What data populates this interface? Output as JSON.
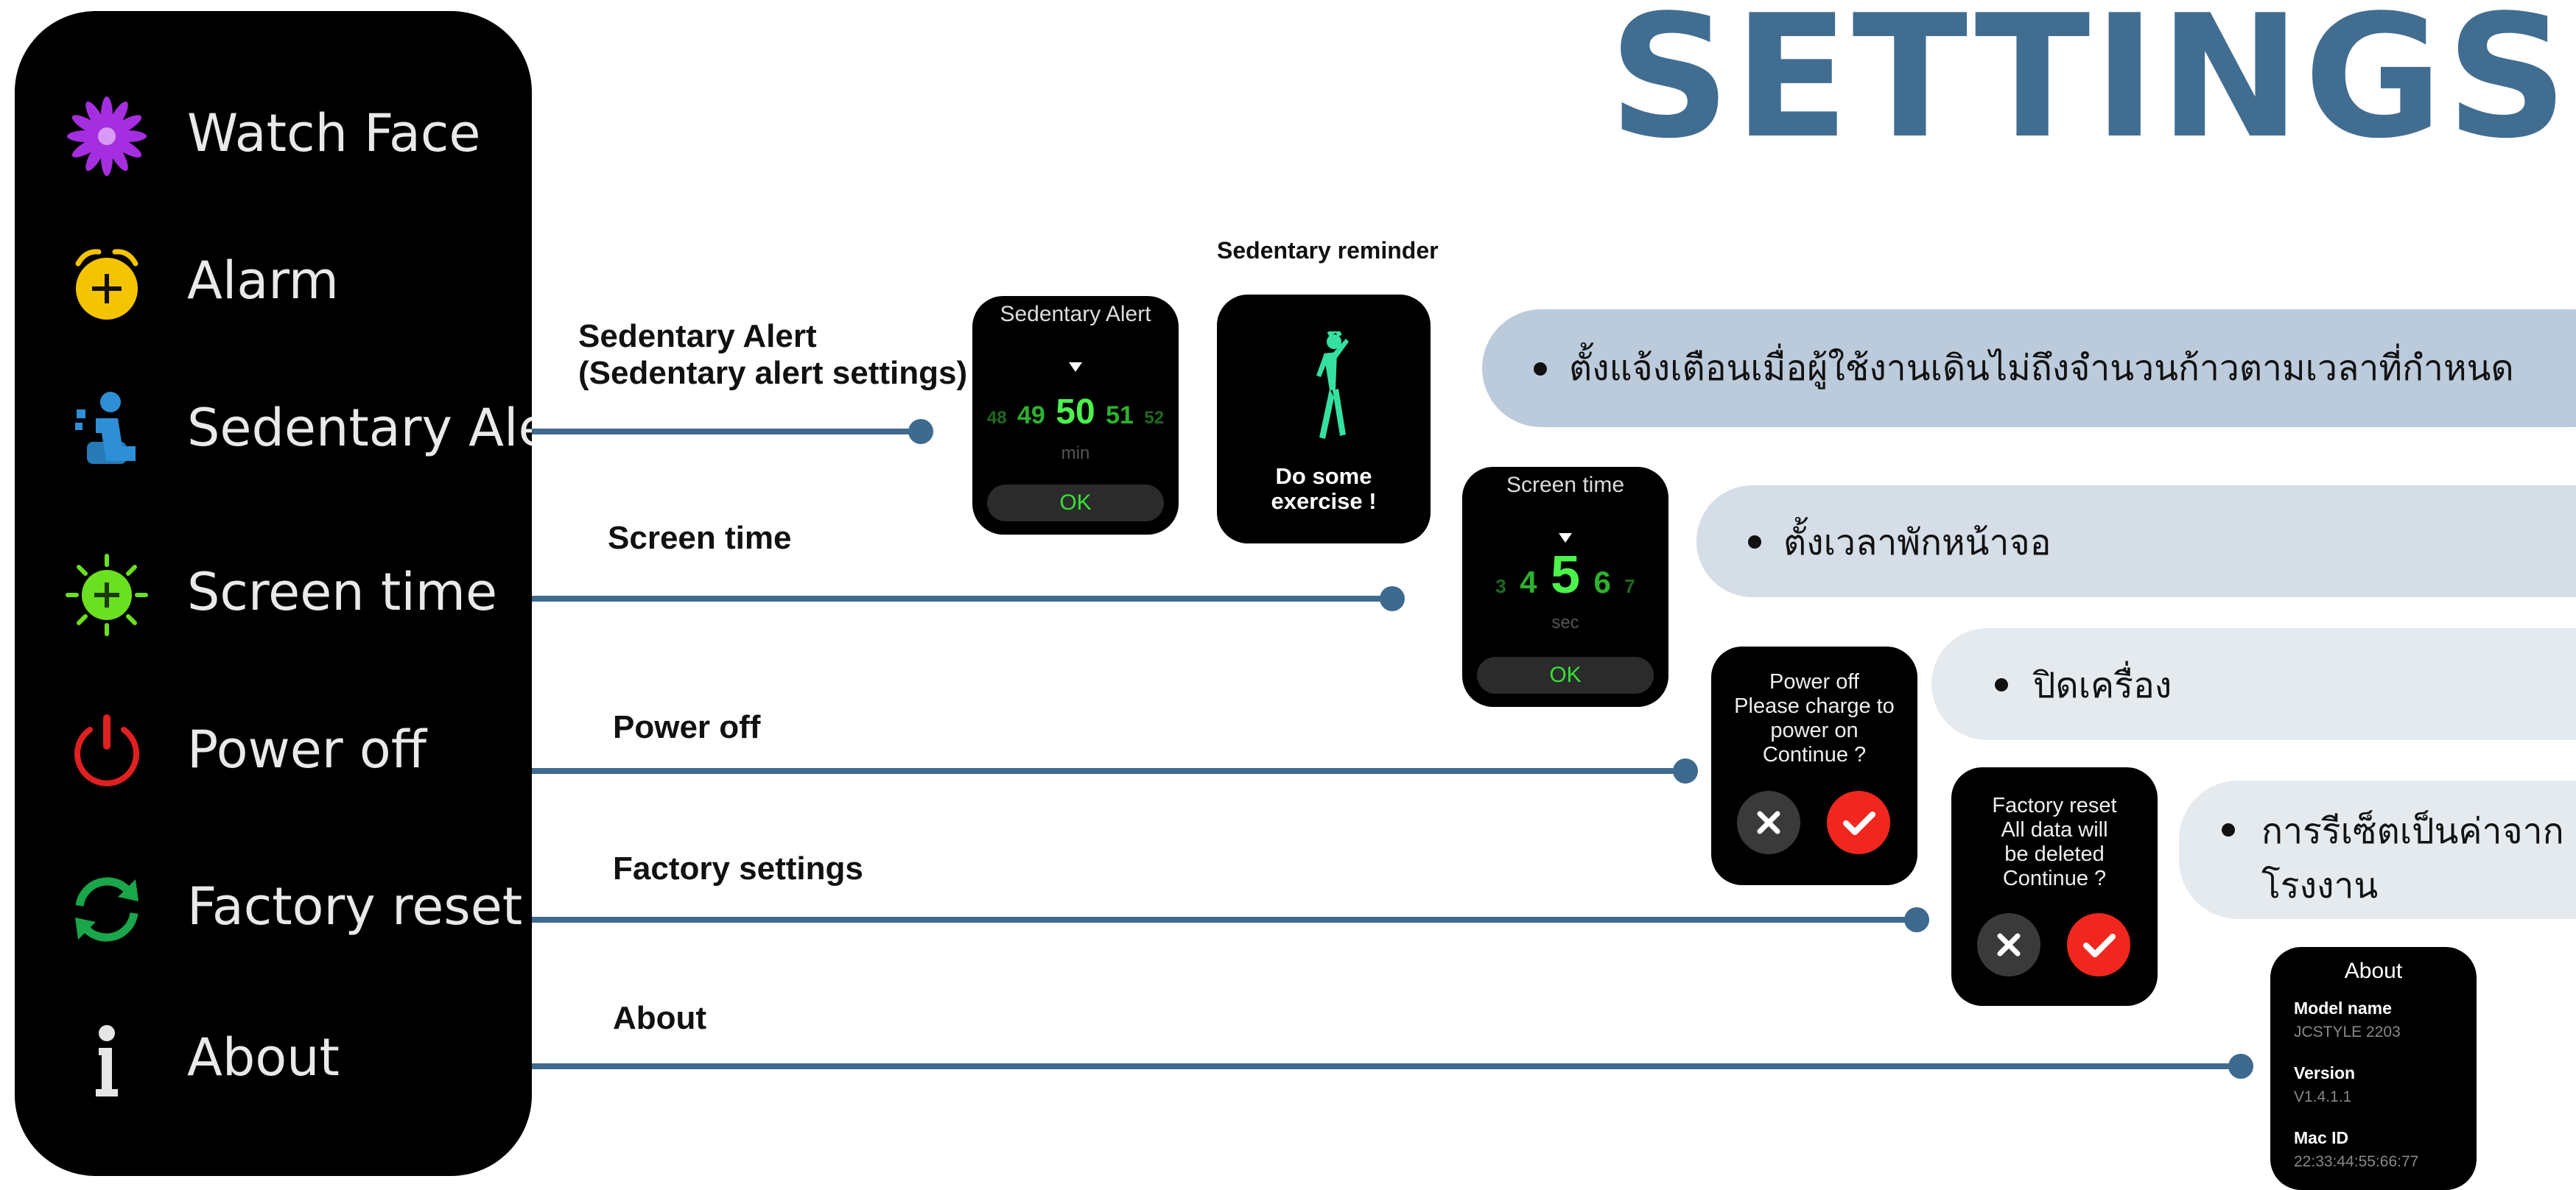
{
  "title": "SETTINGS",
  "menu": [
    {
      "label": "Watch Face",
      "icon": "watch-face-flower-icon"
    },
    {
      "label": "Alarm",
      "icon": "alarm-clock-icon"
    },
    {
      "label": "Sedentary Aler",
      "icon": "sedentary-person-icon"
    },
    {
      "label": "Screen time",
      "icon": "screen-time-sun-icon"
    },
    {
      "label": "Power off",
      "icon": "power-icon"
    },
    {
      "label": "Factory reset",
      "icon": "reset-arrows-icon"
    },
    {
      "label": "About",
      "icon": "info-icon"
    }
  ],
  "connectors": {
    "sedentary": {
      "line1": "Sedentary Alert",
      "line2": "(Sedentary alert settings)"
    },
    "screen_time": "Screen time",
    "power_off": "Power off",
    "factory": "Factory settings",
    "about": "About"
  },
  "sedentary_reminder_caption": "Sedentary reminder",
  "sedentary_watch": {
    "title": "Sedentary Alert",
    "values": [
      "48",
      "49",
      "50",
      "51",
      "52"
    ],
    "unit": "min",
    "ok": "OK"
  },
  "exercise_watch": {
    "line1": "Do some",
    "line2": "exercise !"
  },
  "screen_watch": {
    "title": "Screen time",
    "values": [
      "3",
      "4",
      "5",
      "6",
      "7"
    ],
    "unit": "sec",
    "ok": "OK"
  },
  "power_watch": {
    "line1": "Power off",
    "line2": "Please charge to",
    "line3": "power on",
    "line4": "Continue ?"
  },
  "factory_watch": {
    "line1": "Factory reset",
    "line2": "All data will",
    "line3": "be deleted",
    "line4": "Continue ?"
  },
  "about_watch": {
    "title": "About",
    "model_label": "Model name",
    "model_value": "JCSTYLE 2203",
    "version_label": "Version",
    "version_value": "V1.4.1.1",
    "mac_label": "Mac ID",
    "mac_value": "22:33:44:55:66:77"
  },
  "descriptions": {
    "sedentary": "ตั้งแจ้งเตือนเมื่อผู้ใช้งานเดินไม่ถึงจำนวนก้าวตามเวลาที่กำหนด",
    "screen_time": "ตั้งเวลาพักหน้าจอ",
    "power_off": "ปิดเครื่อง",
    "factory_line1": "การรีเซ็ตเป็นค่าจาก",
    "factory_line2": "โรงงาน"
  },
  "colors": {
    "title": "#416d91",
    "connector": "#3f6a8f",
    "ok_green": "#35e135",
    "confirm_red": "#f1271f",
    "pill_dark": "#bccbdb",
    "pill_mid": "#d5dde6",
    "pill_light": "#e5eaef"
  }
}
